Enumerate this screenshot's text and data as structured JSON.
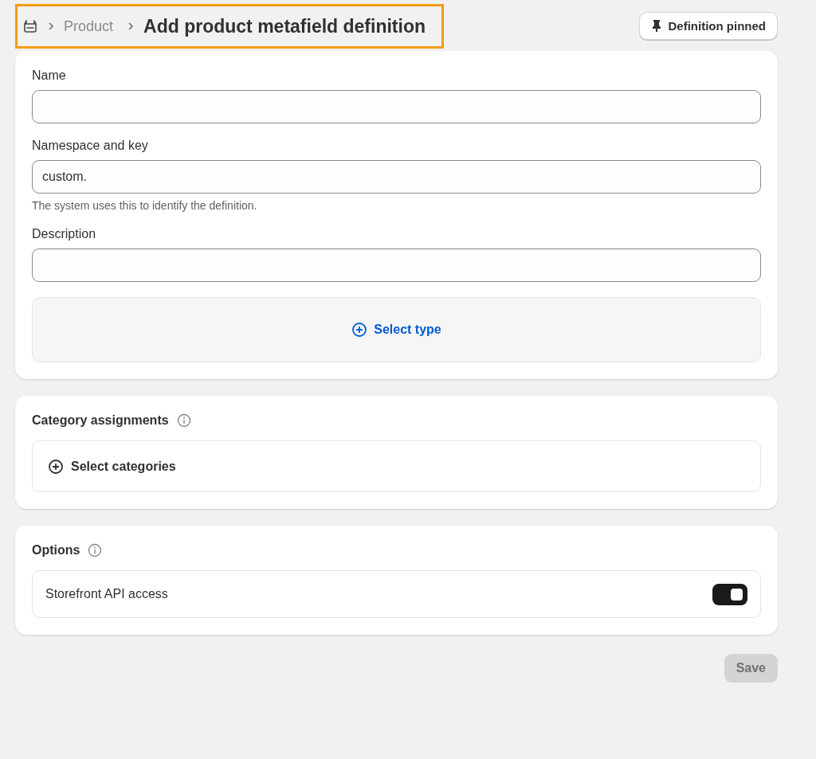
{
  "breadcrumb": {
    "parent": "Product",
    "title": "Add product metafield definition",
    "highlighted": true
  },
  "pin_button": {
    "label": "Definition pinned"
  },
  "fields": [
    {
      "label": "Name"
    },
    {
      "label": "Namespace and key",
      "value": "custom.",
      "help": "The system uses this to identify the definition."
    },
    {
      "label": "Description"
    }
  ],
  "select_type": {
    "label": "Select type"
  },
  "category_assignments": {
    "title": "Category assignments",
    "action": "Select categories"
  },
  "options": {
    "title": "Options",
    "items": [
      {
        "label": "Storefront API access",
        "on": true
      }
    ]
  },
  "save_button": {
    "label": "Save",
    "disabled": true
  }
}
